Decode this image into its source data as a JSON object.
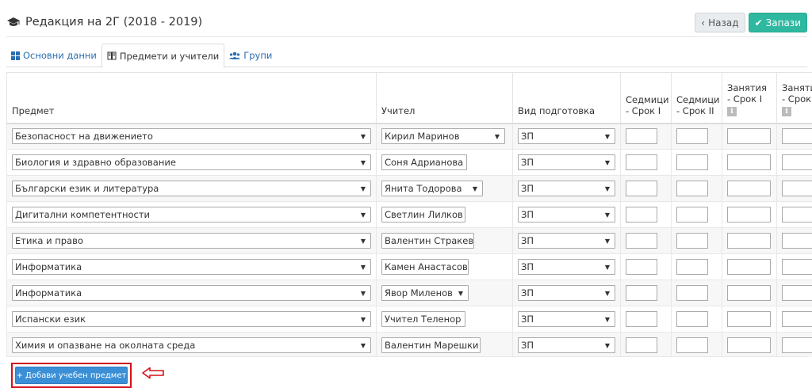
{
  "header": {
    "title": "Редакция на 2Г (2018 - 2019)"
  },
  "toolbar": {
    "back_label": "Назад",
    "save_label": "Запази"
  },
  "tabs": [
    {
      "label": "Основни данни"
    },
    {
      "label": "Предмети и учители"
    },
    {
      "label": "Групи"
    }
  ],
  "table": {
    "headers": {
      "subject": "Предмет",
      "teacher": "Учител",
      "prep": "Вид подготовка",
      "weeks1": "Седмици - Срок I",
      "weeks2": "Седмици - Срок II",
      "lessons1": "Занятия - Срок I",
      "lessons2": "Занятия - Срок"
    },
    "rows": [
      {
        "subject": "Безопасност на движението",
        "teacher": "Кирил Маринов",
        "prep": "ЗП"
      },
      {
        "subject": "Биология и здравно образование",
        "teacher": "Соня Адрианова",
        "prep": "ЗП"
      },
      {
        "subject": "Български език и литература",
        "teacher": "Янита Тодорова",
        "prep": "ЗП"
      },
      {
        "subject": "Дигитални компетентности",
        "teacher": "Светлин Лилков",
        "prep": "ЗП"
      },
      {
        "subject": "Етика и право",
        "teacher": "Валентин Стракев",
        "prep": "ЗП"
      },
      {
        "subject": "Информатика",
        "teacher": "Камен Анастасов",
        "prep": "ЗП"
      },
      {
        "subject": "Информатика",
        "teacher": "Явор Миленов",
        "prep": "ЗП"
      },
      {
        "subject": "Испански език",
        "teacher": "Учител Теленор",
        "prep": "ЗП"
      },
      {
        "subject": "Химия и опазване на околната среда",
        "teacher": "Валентин Марешки",
        "prep": "ЗП"
      }
    ]
  },
  "footer": {
    "add_label": "Добави учебен предмет"
  },
  "colors": {
    "accent": "#3a8fd6",
    "save": "#2eb8a0",
    "highlight": "#d2121a"
  }
}
